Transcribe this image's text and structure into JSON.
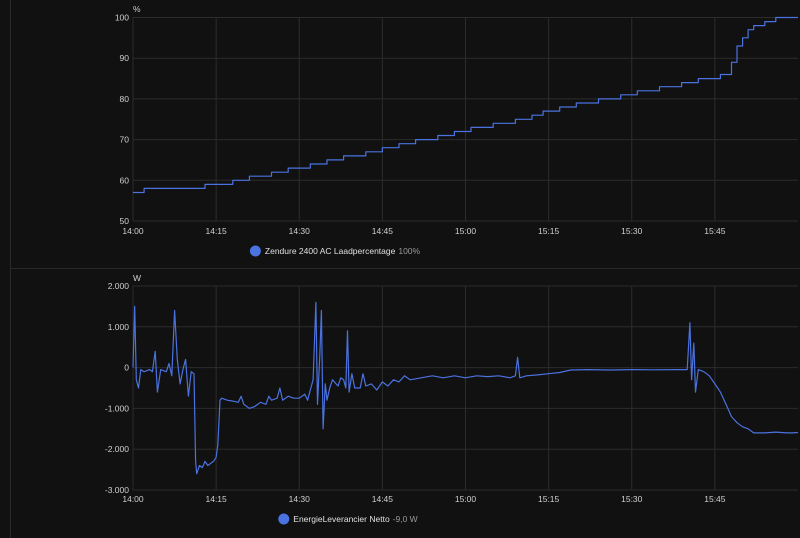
{
  "colors": {
    "background": "#111111",
    "grid": "#2c2c2c",
    "line": "#4a72e0",
    "divider": "#2a2a2a"
  },
  "chart_data": [
    {
      "type": "line",
      "ylabel": "%",
      "ylim": [
        50,
        100
      ],
      "yticks": [
        "100",
        "90",
        "80",
        "70",
        "60",
        "50"
      ],
      "xrange": [
        "14:00",
        "16:00"
      ],
      "xticks": [
        "14:00",
        "14:15",
        "14:30",
        "14:45",
        "15:00",
        "15:15",
        "15:30",
        "15:45"
      ],
      "grid": true,
      "legend_position": "bottom",
      "series": [
        {
          "name": "Zendure 2400 AC Laadpercentage",
          "current": "100%",
          "step": true,
          "points": [
            [
              "14:00",
              57
            ],
            [
              "14:02",
              58
            ],
            [
              "14:13",
              59
            ],
            [
              "14:18",
              60
            ],
            [
              "14:21",
              61
            ],
            [
              "14:25",
              62
            ],
            [
              "14:28",
              63
            ],
            [
              "14:32",
              64
            ],
            [
              "14:35",
              65
            ],
            [
              "14:38",
              66
            ],
            [
              "14:42",
              67
            ],
            [
              "14:45",
              68
            ],
            [
              "14:48",
              69
            ],
            [
              "14:51",
              70
            ],
            [
              "14:55",
              71
            ],
            [
              "14:58",
              72
            ],
            [
              "15:01",
              73
            ],
            [
              "15:05",
              74
            ],
            [
              "15:09",
              75
            ],
            [
              "15:12",
              76
            ],
            [
              "15:14",
              77
            ],
            [
              "15:17",
              78
            ],
            [
              "15:20",
              79
            ],
            [
              "15:24",
              80
            ],
            [
              "15:28",
              81
            ],
            [
              "15:31",
              82
            ],
            [
              "15:35",
              83
            ],
            [
              "15:39",
              84
            ],
            [
              "15:42",
              85
            ],
            [
              "15:46",
              86
            ],
            [
              "15:48",
              89
            ],
            [
              "15:49",
              93
            ],
            [
              "15:50",
              95
            ],
            [
              "15:51",
              97
            ],
            [
              "15:52",
              98
            ],
            [
              "15:54",
              99
            ],
            [
              "15:56",
              100
            ],
            [
              "16:00",
              100
            ]
          ]
        }
      ]
    },
    {
      "type": "line",
      "ylabel": "W",
      "ylim": [
        -3000,
        2000
      ],
      "yticks": [
        "2.000",
        "1.000",
        "0",
        "-1.000",
        "-2.000",
        "-3.000"
      ],
      "xrange": [
        "14:00",
        "16:00"
      ],
      "xticks": [
        "14:00",
        "14:15",
        "14:30",
        "14:45",
        "15:00",
        "15:15",
        "15:30",
        "15:45"
      ],
      "grid": true,
      "legend_position": "bottom",
      "series": [
        {
          "name": "EnergieLeverancier Netto",
          "current": "-9,0 W",
          "step": false,
          "points": [
            [
              "14:00",
              0
            ],
            [
              "14:00.3",
              1500
            ],
            [
              "14:00.6",
              -300
            ],
            [
              "14:01",
              -500
            ],
            [
              "14:01.4",
              -50
            ],
            [
              "14:02",
              -100
            ],
            [
              "14:03",
              -50
            ],
            [
              "14:03.5",
              -100
            ],
            [
              "14:04",
              400
            ],
            [
              "14:04.4",
              -600
            ],
            [
              "14:05",
              -50
            ],
            [
              "14:06",
              -100
            ],
            [
              "14:06.5",
              100
            ],
            [
              "14:07",
              -200
            ],
            [
              "14:07.5",
              1400
            ],
            [
              "14:08",
              200
            ],
            [
              "14:08.5",
              -400
            ],
            [
              "14:09",
              -50
            ],
            [
              "14:09.5",
              200
            ],
            [
              "14:10",
              -700
            ],
            [
              "14:10.5",
              -100
            ],
            [
              "14:11",
              -150
            ],
            [
              "14:11.3",
              -2300
            ],
            [
              "14:11.5",
              -2600
            ],
            [
              "14:12",
              -2400
            ],
            [
              "14:12.5",
              -2450
            ],
            [
              "14:13",
              -2300
            ],
            [
              "14:13.5",
              -2400
            ],
            [
              "14:14",
              -2350
            ],
            [
              "14:14.5",
              -2300
            ],
            [
              "14:15",
              -2200
            ],
            [
              "14:15.3",
              -1900
            ],
            [
              "14:15.7",
              -800
            ],
            [
              "14:16",
              -750
            ],
            [
              "14:17",
              -800
            ],
            [
              "14:18",
              -820
            ],
            [
              "14:19",
              -850
            ],
            [
              "14:19.5",
              -700
            ],
            [
              "14:20",
              -900
            ],
            [
              "14:21",
              -1000
            ],
            [
              "14:22",
              -950
            ],
            [
              "14:23",
              -850
            ],
            [
              "14:24",
              -900
            ],
            [
              "14:24.5",
              -700
            ],
            [
              "14:25",
              -800
            ],
            [
              "14:26",
              -750
            ],
            [
              "14:26.5",
              -500
            ],
            [
              "14:27",
              -800
            ],
            [
              "14:28",
              -700
            ],
            [
              "14:29",
              -750
            ],
            [
              "14:30",
              -750
            ],
            [
              "14:31",
              -650
            ],
            [
              "14:31.5",
              -800
            ],
            [
              "14:32",
              -550
            ],
            [
              "14:32.5",
              -300
            ],
            [
              "14:33",
              1600
            ],
            [
              "14:33.3",
              -900
            ],
            [
              "14:33.7",
              300
            ],
            [
              "14:34",
              1400
            ],
            [
              "14:34.3",
              -1500
            ],
            [
              "14:34.7",
              -400
            ],
            [
              "14:35",
              -800
            ],
            [
              "14:35.5",
              -500
            ],
            [
              "14:36",
              -300
            ],
            [
              "14:37",
              -450
            ],
            [
              "14:37.5",
              -250
            ],
            [
              "14:38",
              -300
            ],
            [
              "14:38.4",
              -500
            ],
            [
              "14:38.7",
              900
            ],
            [
              "14:39",
              -600
            ],
            [
              "14:39.5",
              -150
            ],
            [
              "14:40",
              -500
            ],
            [
              "14:41",
              -500
            ],
            [
              "14:41.5",
              -150
            ],
            [
              "14:42",
              -450
            ],
            [
              "14:43",
              -400
            ],
            [
              "14:44",
              -550
            ],
            [
              "14:45",
              -350
            ],
            [
              "14:46",
              -450
            ],
            [
              "14:47",
              -300
            ],
            [
              "14:48",
              -350
            ],
            [
              "14:49",
              -200
            ],
            [
              "14:50",
              -300
            ],
            [
              "14:52",
              -250
            ],
            [
              "14:54",
              -200
            ],
            [
              "14:56",
              -250
            ],
            [
              "14:58",
              -200
            ],
            [
              "15:00",
              -250
            ],
            [
              "15:02",
              -200
            ],
            [
              "15:04",
              -220
            ],
            [
              "15:06",
              -200
            ],
            [
              "15:08",
              -250
            ],
            [
              "15:09",
              -200
            ],
            [
              "15:09.4",
              250
            ],
            [
              "15:09.8",
              -250
            ],
            [
              "15:11",
              -200
            ],
            [
              "15:13",
              -180
            ],
            [
              "15:15",
              -150
            ],
            [
              "15:17",
              -120
            ],
            [
              "15:19",
              -60
            ],
            [
              "15:22",
              -50
            ],
            [
              "15:26",
              -60
            ],
            [
              "15:30",
              -50
            ],
            [
              "15:34",
              -55
            ],
            [
              "15:38",
              -50
            ],
            [
              "15:40",
              -50
            ],
            [
              "15:40.5",
              1100
            ],
            [
              "15:40.8",
              -300
            ],
            [
              "15:41.2",
              600
            ],
            [
              "15:41.5",
              -600
            ],
            [
              "15:42",
              -50
            ],
            [
              "15:43",
              -100
            ],
            [
              "15:44",
              -200
            ],
            [
              "15:45",
              -400
            ],
            [
              "15:46",
              -600
            ],
            [
              "15:47",
              -900
            ],
            [
              "15:48",
              -1200
            ],
            [
              "15:49",
              -1350
            ],
            [
              "15:50",
              -1450
            ],
            [
              "15:51",
              -1500
            ],
            [
              "15:52",
              -1600
            ],
            [
              "15:54",
              -1600
            ],
            [
              "15:56",
              -1580
            ],
            [
              "15:58",
              -1600
            ],
            [
              "15:59",
              -1600
            ],
            [
              "16:00",
              -1590
            ]
          ]
        }
      ]
    }
  ]
}
